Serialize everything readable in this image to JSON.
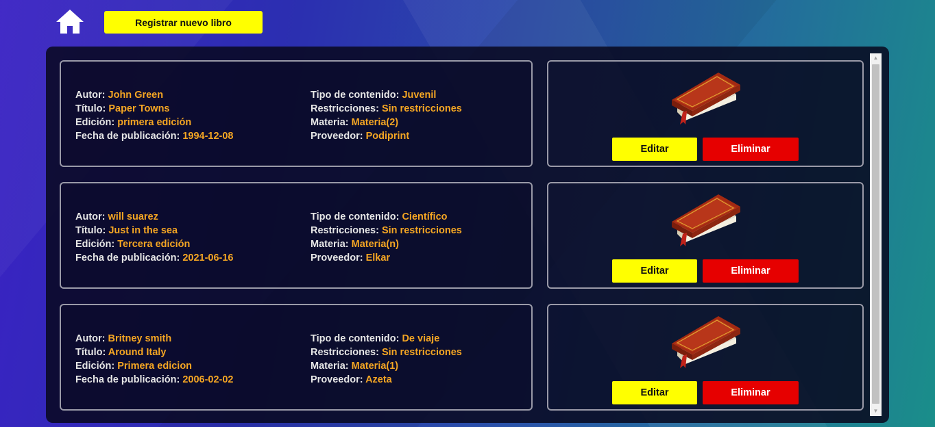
{
  "header": {
    "home_icon": "home-icon",
    "register_label": "Registrar nuevo libro"
  },
  "labels": {
    "autor": "Autor:",
    "titulo": "Título:",
    "edicion": "Edición:",
    "fecha": "Fecha de publicación:",
    "tipo": "Tipo de contenido:",
    "restricciones": "Restricciones:",
    "materia": "Materia:",
    "proveedor": "Proveedor:",
    "edit_button": "Editar",
    "delete_button": "Eliminar"
  },
  "books": [
    {
      "autor": "John Green",
      "titulo": "Paper Towns",
      "edicion": "primera edición",
      "fecha": "1994-12-08",
      "tipo": "Juvenil",
      "restricciones": "Sin restricciones",
      "materia": "Materia(2)",
      "proveedor": "Podiprint",
      "icon": "book-icon"
    },
    {
      "autor": "will suarez",
      "titulo": "Just in the sea",
      "edicion": "Tercera edición",
      "fecha": "2021-06-16",
      "tipo": "Científico",
      "restricciones": "Sin restricciones",
      "materia": "Materia(n)",
      "proveedor": "Elkar",
      "icon": "book-icon"
    },
    {
      "autor": "Britney smith",
      "titulo": "Around Italy",
      "edicion": "Primera edicion",
      "fecha": "2006-02-02",
      "tipo": "De viaje",
      "restricciones": "Sin restricciones",
      "materia": "Materia(1)",
      "proveedor": "Azeta",
      "icon": "book-icon"
    }
  ],
  "colors": {
    "label": "#e6e6e6",
    "value": "#f5a623",
    "edit_button": "#ffff00",
    "delete_button": "#e60000",
    "register_button": "#ffff00"
  }
}
